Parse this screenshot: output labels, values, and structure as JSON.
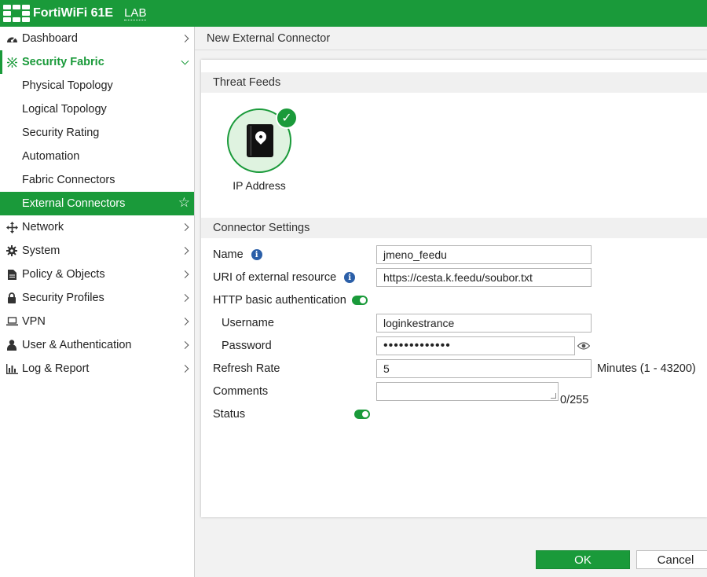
{
  "topbar": {
    "device_name": "FortiWiFi 61E",
    "device_tag": "LAB",
    "brand_color": "#1a9a3a"
  },
  "sidebar": {
    "items": [
      {
        "label": "Dashboard",
        "icon": "dashboard-icon"
      },
      {
        "label": "Security Fabric",
        "icon": "security-fabric-icon"
      },
      {
        "label": "Physical Topology"
      },
      {
        "label": "Logical Topology"
      },
      {
        "label": "Security Rating"
      },
      {
        "label": "Automation"
      },
      {
        "label": "Fabric Connectors"
      },
      {
        "label": "External Connectors",
        "icon": "star-icon"
      },
      {
        "label": "Network",
        "icon": "network-icon"
      },
      {
        "label": "System",
        "icon": "gear-icon"
      },
      {
        "label": "Policy & Objects",
        "icon": "policy-icon"
      },
      {
        "label": "Security Profiles",
        "icon": "lock-icon"
      },
      {
        "label": "VPN",
        "icon": "laptop-icon"
      },
      {
        "label": "User & Authentication",
        "icon": "user-icon"
      },
      {
        "label": "Log & Report",
        "icon": "bar-chart-icon"
      }
    ]
  },
  "main": {
    "page_title": "New External Connector",
    "threat_feeds": {
      "heading": "Threat Feeds",
      "tile_label": "IP Address",
      "tile_icon": "address-book-icon",
      "badge_icon": "check-icon"
    },
    "settings": {
      "heading": "Connector Settings",
      "name_label": "Name",
      "name_value": "jmeno_feedu",
      "uri_label": "URI of external resource",
      "uri_value": "https://cesta.k.feedu/soubor.txt",
      "http_auth_label": "HTTP basic authentication",
      "username_label": "Username",
      "username_value": "loginkestrance",
      "password_label": "Password",
      "password_value": "•••••••••••••",
      "refresh_label": "Refresh Rate",
      "refresh_value": "5",
      "refresh_units": "Minutes (1 - 43200)",
      "comments_label": "Comments",
      "comments_counter": "0/255",
      "status_label": "Status"
    },
    "buttons": {
      "ok": "OK",
      "cancel": "Cancel"
    }
  }
}
